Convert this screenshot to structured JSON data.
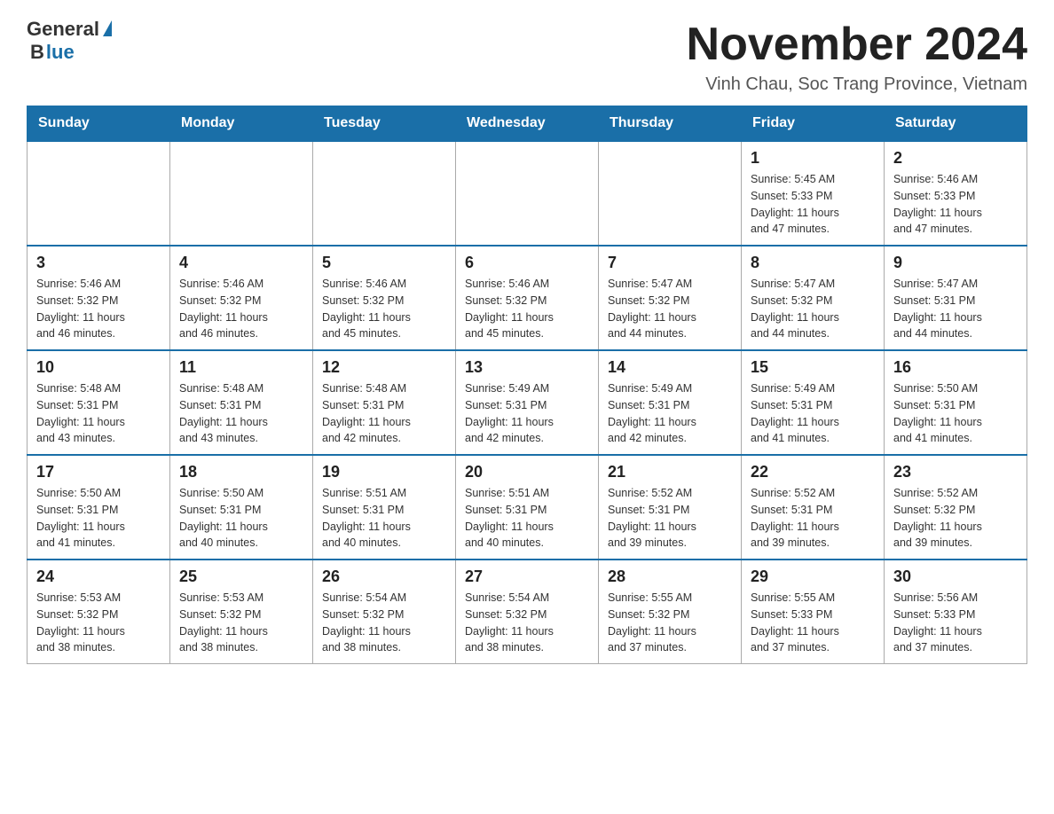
{
  "logo": {
    "general": "General",
    "blue": "Blue"
  },
  "title": "November 2024",
  "subtitle": "Vinh Chau, Soc Trang Province, Vietnam",
  "days_of_week": [
    "Sunday",
    "Monday",
    "Tuesday",
    "Wednesday",
    "Thursday",
    "Friday",
    "Saturday"
  ],
  "weeks": [
    [
      {
        "day": "",
        "info": ""
      },
      {
        "day": "",
        "info": ""
      },
      {
        "day": "",
        "info": ""
      },
      {
        "day": "",
        "info": ""
      },
      {
        "day": "",
        "info": ""
      },
      {
        "day": "1",
        "info": "Sunrise: 5:45 AM\nSunset: 5:33 PM\nDaylight: 11 hours\nand 47 minutes."
      },
      {
        "day": "2",
        "info": "Sunrise: 5:46 AM\nSunset: 5:33 PM\nDaylight: 11 hours\nand 47 minutes."
      }
    ],
    [
      {
        "day": "3",
        "info": "Sunrise: 5:46 AM\nSunset: 5:32 PM\nDaylight: 11 hours\nand 46 minutes."
      },
      {
        "day": "4",
        "info": "Sunrise: 5:46 AM\nSunset: 5:32 PM\nDaylight: 11 hours\nand 46 minutes."
      },
      {
        "day": "5",
        "info": "Sunrise: 5:46 AM\nSunset: 5:32 PM\nDaylight: 11 hours\nand 45 minutes."
      },
      {
        "day": "6",
        "info": "Sunrise: 5:46 AM\nSunset: 5:32 PM\nDaylight: 11 hours\nand 45 minutes."
      },
      {
        "day": "7",
        "info": "Sunrise: 5:47 AM\nSunset: 5:32 PM\nDaylight: 11 hours\nand 44 minutes."
      },
      {
        "day": "8",
        "info": "Sunrise: 5:47 AM\nSunset: 5:32 PM\nDaylight: 11 hours\nand 44 minutes."
      },
      {
        "day": "9",
        "info": "Sunrise: 5:47 AM\nSunset: 5:31 PM\nDaylight: 11 hours\nand 44 minutes."
      }
    ],
    [
      {
        "day": "10",
        "info": "Sunrise: 5:48 AM\nSunset: 5:31 PM\nDaylight: 11 hours\nand 43 minutes."
      },
      {
        "day": "11",
        "info": "Sunrise: 5:48 AM\nSunset: 5:31 PM\nDaylight: 11 hours\nand 43 minutes."
      },
      {
        "day": "12",
        "info": "Sunrise: 5:48 AM\nSunset: 5:31 PM\nDaylight: 11 hours\nand 42 minutes."
      },
      {
        "day": "13",
        "info": "Sunrise: 5:49 AM\nSunset: 5:31 PM\nDaylight: 11 hours\nand 42 minutes."
      },
      {
        "day": "14",
        "info": "Sunrise: 5:49 AM\nSunset: 5:31 PM\nDaylight: 11 hours\nand 42 minutes."
      },
      {
        "day": "15",
        "info": "Sunrise: 5:49 AM\nSunset: 5:31 PM\nDaylight: 11 hours\nand 41 minutes."
      },
      {
        "day": "16",
        "info": "Sunrise: 5:50 AM\nSunset: 5:31 PM\nDaylight: 11 hours\nand 41 minutes."
      }
    ],
    [
      {
        "day": "17",
        "info": "Sunrise: 5:50 AM\nSunset: 5:31 PM\nDaylight: 11 hours\nand 41 minutes."
      },
      {
        "day": "18",
        "info": "Sunrise: 5:50 AM\nSunset: 5:31 PM\nDaylight: 11 hours\nand 40 minutes."
      },
      {
        "day": "19",
        "info": "Sunrise: 5:51 AM\nSunset: 5:31 PM\nDaylight: 11 hours\nand 40 minutes."
      },
      {
        "day": "20",
        "info": "Sunrise: 5:51 AM\nSunset: 5:31 PM\nDaylight: 11 hours\nand 40 minutes."
      },
      {
        "day": "21",
        "info": "Sunrise: 5:52 AM\nSunset: 5:31 PM\nDaylight: 11 hours\nand 39 minutes."
      },
      {
        "day": "22",
        "info": "Sunrise: 5:52 AM\nSunset: 5:31 PM\nDaylight: 11 hours\nand 39 minutes."
      },
      {
        "day": "23",
        "info": "Sunrise: 5:52 AM\nSunset: 5:32 PM\nDaylight: 11 hours\nand 39 minutes."
      }
    ],
    [
      {
        "day": "24",
        "info": "Sunrise: 5:53 AM\nSunset: 5:32 PM\nDaylight: 11 hours\nand 38 minutes."
      },
      {
        "day": "25",
        "info": "Sunrise: 5:53 AM\nSunset: 5:32 PM\nDaylight: 11 hours\nand 38 minutes."
      },
      {
        "day": "26",
        "info": "Sunrise: 5:54 AM\nSunset: 5:32 PM\nDaylight: 11 hours\nand 38 minutes."
      },
      {
        "day": "27",
        "info": "Sunrise: 5:54 AM\nSunset: 5:32 PM\nDaylight: 11 hours\nand 38 minutes."
      },
      {
        "day": "28",
        "info": "Sunrise: 5:55 AM\nSunset: 5:32 PM\nDaylight: 11 hours\nand 37 minutes."
      },
      {
        "day": "29",
        "info": "Sunrise: 5:55 AM\nSunset: 5:33 PM\nDaylight: 11 hours\nand 37 minutes."
      },
      {
        "day": "30",
        "info": "Sunrise: 5:56 AM\nSunset: 5:33 PM\nDaylight: 11 hours\nand 37 minutes."
      }
    ]
  ]
}
